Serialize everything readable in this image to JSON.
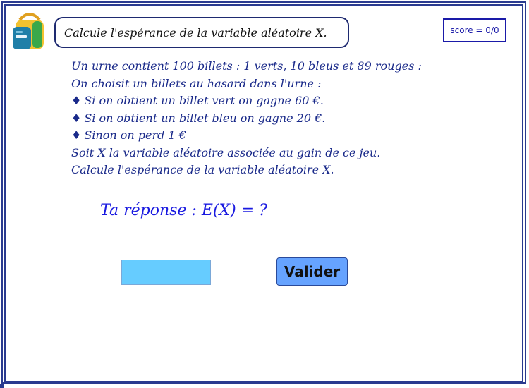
{
  "header": {
    "title": "Calcule l'espérance de la variable aléatoire X.",
    "score_label": "score = 0/0"
  },
  "logo": {
    "icon": "backpack-icon"
  },
  "problem": {
    "lines": [
      "Un urne contient 100 billets : 1 verts, 10 bleus et 89 rouges :",
      "On choisit un billets au hasard dans l'urne :",
      "Si on obtient un billet vert on gagne 60 €.",
      "Si on obtient un billet bleu on gagne 20 €.",
      "Sinon on perd 1 €",
      "Soit X la variable aléatoire associée au gain de ce jeu.",
      "Calcule l'espérance de la variable aléatoire X."
    ],
    "bullet": "♦"
  },
  "answer": {
    "prompt": "Ta réponse :  E(X) = ?",
    "input_value": "",
    "submit_label": "Valider"
  },
  "colors": {
    "frame": "#2a3a8f",
    "problem_text": "#1a2a8a",
    "prompt_text": "#1a1ae0",
    "input_bg": "#66ccff",
    "button_bg": "#66a3ff"
  }
}
